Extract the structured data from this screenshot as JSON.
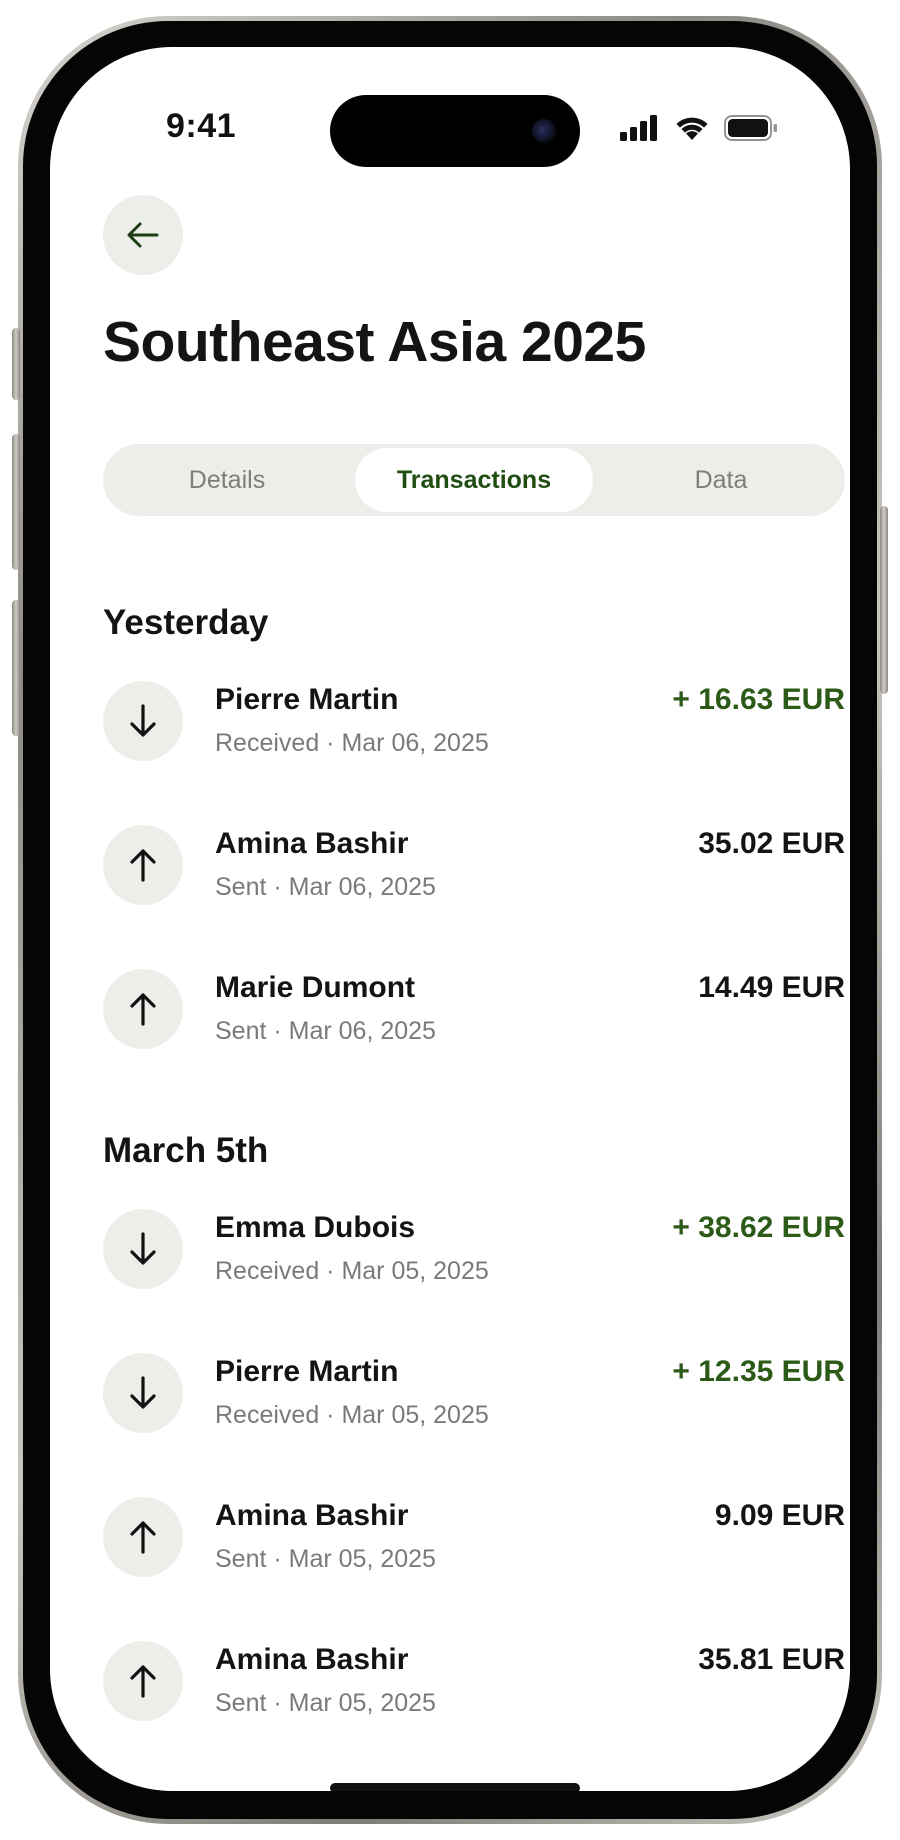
{
  "status_bar": {
    "time": "9:41"
  },
  "header": {
    "back_icon": "arrow-left-icon",
    "title": "Southeast Asia 2025"
  },
  "tabs": [
    {
      "label": "Details",
      "selected": false
    },
    {
      "label": "Transactions",
      "selected": true
    },
    {
      "label": "Data",
      "selected": false
    }
  ],
  "colors": {
    "accent_green": "#2c5a17",
    "tab_selected_text": "#1f4d12",
    "chip_background": "#eceeea"
  },
  "sections": [
    {
      "heading": "Yesterday",
      "transactions": [
        {
          "direction_icon": "arrow-down-icon",
          "name": "Pierre Martin",
          "detail": "Received · Mar 06, 2025",
          "amount": "+ 16.63 EUR",
          "positive": true
        },
        {
          "direction_icon": "arrow-up-icon",
          "name": "Amina Bashir",
          "detail": "Sent · Mar 06, 2025",
          "amount": "35.02 EUR",
          "positive": false
        },
        {
          "direction_icon": "arrow-up-icon",
          "name": "Marie Dumont",
          "detail": "Sent · Mar 06, 2025",
          "amount": "14.49 EUR",
          "positive": false
        }
      ]
    },
    {
      "heading": "March 5th",
      "transactions": [
        {
          "direction_icon": "arrow-down-icon",
          "name": "Emma Dubois",
          "detail": "Received · Mar 05, 2025",
          "amount": "+ 38.62 EUR",
          "positive": true
        },
        {
          "direction_icon": "arrow-down-icon",
          "name": "Pierre Martin",
          "detail": "Received · Mar 05, 2025",
          "amount": "+ 12.35 EUR",
          "positive": true
        },
        {
          "direction_icon": "arrow-up-icon",
          "name": "Amina Bashir",
          "detail": "Sent · Mar 05, 2025",
          "amount": "9.09 EUR",
          "positive": false
        },
        {
          "direction_icon": "arrow-up-icon",
          "name": "Amina Bashir",
          "detail": "Sent · Mar 05, 2025",
          "amount": "35.81 EUR",
          "positive": false
        }
      ]
    }
  ]
}
